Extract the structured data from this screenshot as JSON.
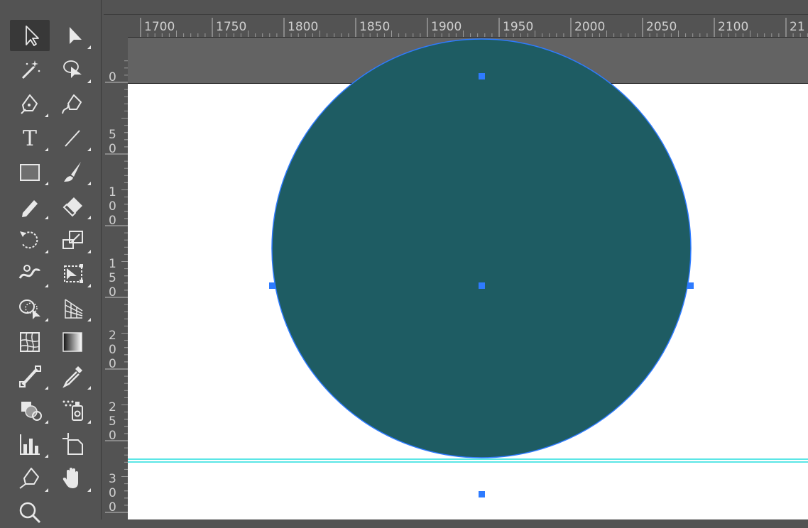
{
  "colors": {
    "panel": "#535353",
    "pasteboard": "#636363",
    "artboard": "#ffffff",
    "shape_fill": "#1e5c63",
    "selection": "#2e7bff",
    "guide": "#5ce6e6",
    "icon": "#e8e8e8"
  },
  "tools": [
    {
      "name": "selection-tool",
      "icon": "arrow-outline-icon",
      "active": true
    },
    {
      "name": "direct-selection-tool",
      "icon": "arrow-filled-icon"
    },
    {
      "name": "magic-wand-tool",
      "icon": "magic-wand-icon"
    },
    {
      "name": "lasso-tool",
      "icon": "lasso-icon"
    },
    {
      "name": "pen-tool",
      "icon": "pen-icon"
    },
    {
      "name": "curvature-tool",
      "icon": "curvature-icon"
    },
    {
      "name": "type-tool",
      "icon": "type-icon",
      "label": "T"
    },
    {
      "name": "line-segment-tool",
      "icon": "line-icon"
    },
    {
      "name": "rectangle-tool",
      "icon": "rectangle-icon"
    },
    {
      "name": "paintbrush-tool",
      "icon": "brush-icon"
    },
    {
      "name": "pencil-tool",
      "icon": "pencil-icon"
    },
    {
      "name": "eraser-tool",
      "icon": "eraser-icon"
    },
    {
      "name": "rotate-tool",
      "icon": "rotate-icon"
    },
    {
      "name": "scale-tool",
      "icon": "scale-icon"
    },
    {
      "name": "width-tool",
      "icon": "width-icon"
    },
    {
      "name": "free-transform-tool",
      "icon": "free-transform-icon"
    },
    {
      "name": "shape-builder-tool",
      "icon": "shape-builder-icon"
    },
    {
      "name": "perspective-grid-tool",
      "icon": "perspective-grid-icon"
    },
    {
      "name": "mesh-tool",
      "icon": "mesh-icon"
    },
    {
      "name": "gradient-tool",
      "icon": "gradient-icon"
    },
    {
      "name": "blend-tool",
      "icon": "blend-icon"
    },
    {
      "name": "eyedropper-tool",
      "icon": "eyedropper-icon"
    },
    {
      "name": "live-paint-tool",
      "icon": "live-paint-icon"
    },
    {
      "name": "symbol-sprayer-tool",
      "icon": "symbol-sprayer-icon"
    },
    {
      "name": "column-graph-tool",
      "icon": "column-graph-icon"
    },
    {
      "name": "artboard-tool",
      "icon": "artboard-icon"
    },
    {
      "name": "anchor-point-tool",
      "icon": "anchor-pen-icon"
    },
    {
      "name": "hand-tool",
      "icon": "hand-icon"
    },
    {
      "name": "zoom-tool",
      "icon": "zoom-icon"
    }
  ],
  "rulers": {
    "horizontal": [
      "1700",
      "1750",
      "1800",
      "1850",
      "1900",
      "1950",
      "2000",
      "2050",
      "2100",
      "21"
    ],
    "vertical": [
      "0",
      "50",
      "100",
      "150",
      "200",
      "250",
      "300"
    ]
  },
  "canvas": {
    "shape": "ellipse",
    "selected": true
  }
}
